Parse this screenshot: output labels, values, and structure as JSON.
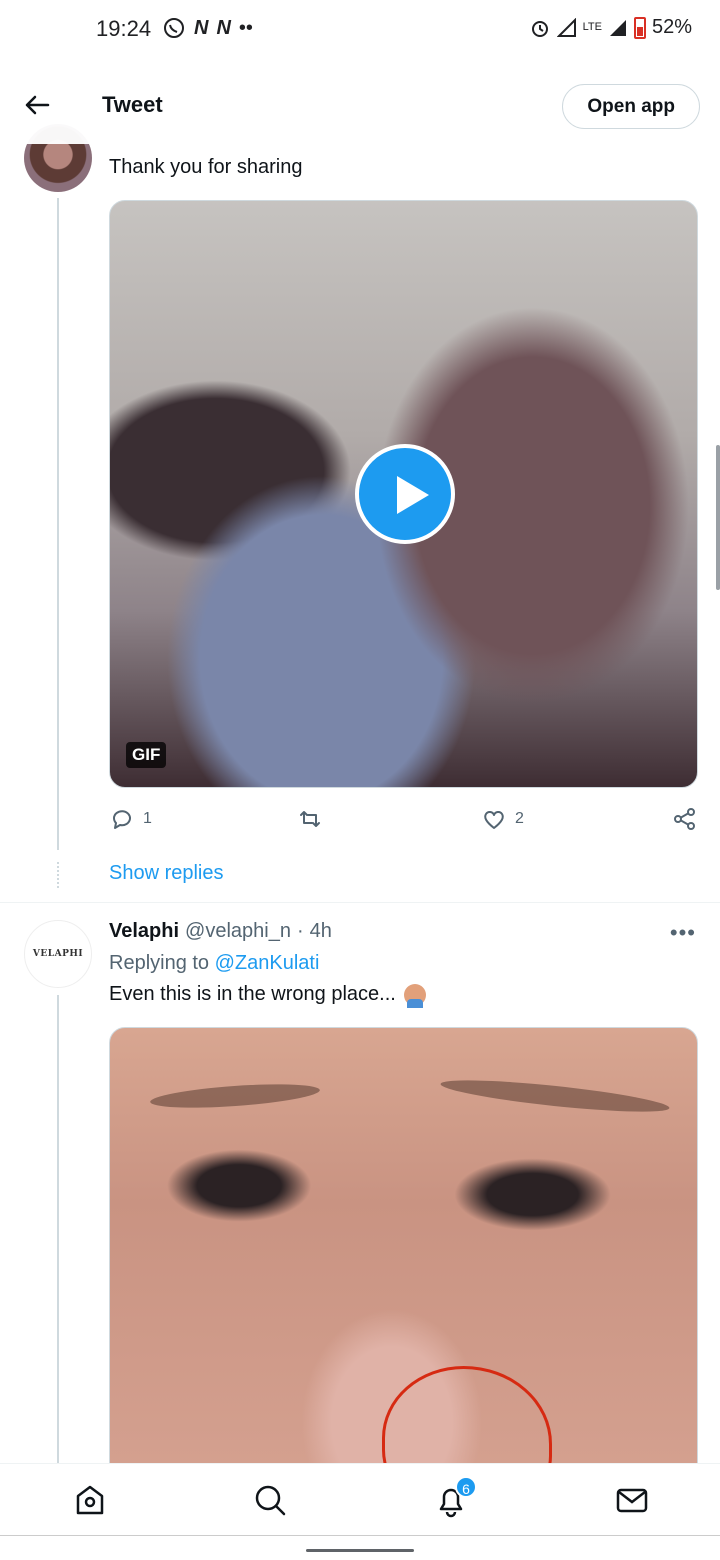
{
  "status_bar": {
    "time": "19:24",
    "notification_icons": [
      "whatsapp-icon",
      "news-icon",
      "news-icon",
      "more-dots-icon"
    ],
    "right_icons": [
      "alarm-icon",
      "signal-icon",
      "lte-icon",
      "signal-icon",
      "battery-icon"
    ],
    "lte_label": "LTE",
    "battery": "52%"
  },
  "header": {
    "title": "Tweet",
    "open_app_label": "Open app"
  },
  "tweet1": {
    "text": "Thank you for sharing",
    "media_badge": "GIF",
    "reply_count": "1",
    "like_count": "2",
    "show_replies": "Show replies"
  },
  "tweet2": {
    "avatar_text": "VELAPHI",
    "name": "Velaphi",
    "handle": "@velaphi_n",
    "separator": "·",
    "time": "4h",
    "replying_to_prefix": "Replying to",
    "replying_to_handle": "@ZanKulati",
    "text": "Even this is in the wrong place...",
    "more": "•••"
  },
  "bottom_nav": {
    "items": [
      "home-icon",
      "search-icon",
      "notifications-icon",
      "messages-icon"
    ],
    "notification_count": "6"
  },
  "colors": {
    "accent": "#1d9bf0",
    "text": "#0f1419",
    "muted": "#536471",
    "border": "#cfd9de"
  }
}
